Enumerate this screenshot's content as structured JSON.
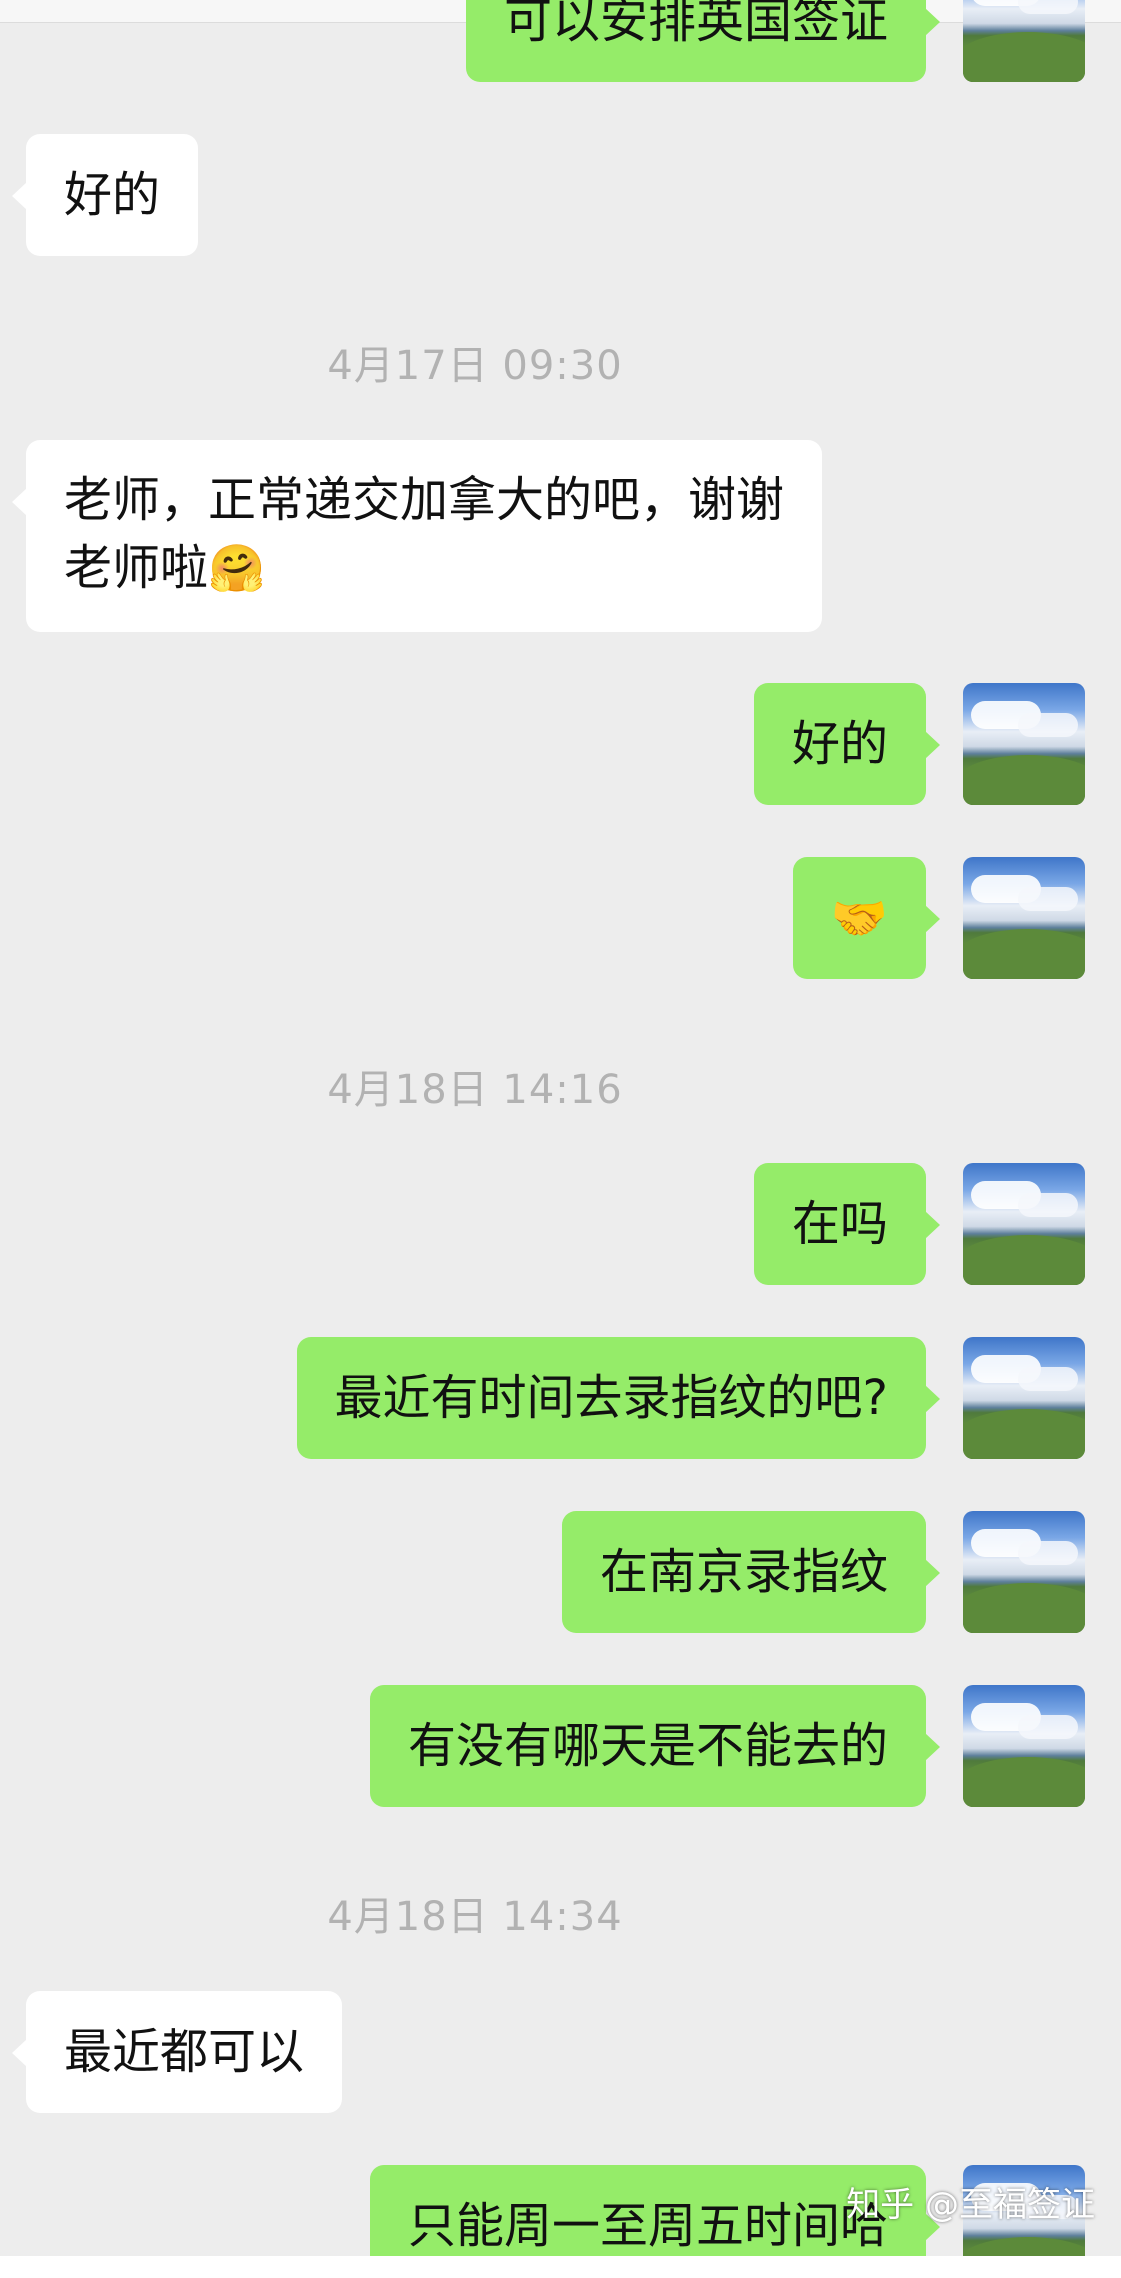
{
  "messages": [
    {
      "side": "right",
      "text": "可以安排英国签证"
    },
    {
      "side": "left",
      "text": "好的"
    },
    {
      "timestamp": "4月17日 09:30"
    },
    {
      "side": "left",
      "line1": "老师，正常递交加拿大的吧，谢谢",
      "line2": "老师啦",
      "emoji": "🤗"
    },
    {
      "side": "right",
      "text": "好的"
    },
    {
      "side": "right",
      "emoji": "🤝"
    },
    {
      "timestamp": "4月18日 14:16"
    },
    {
      "side": "right",
      "text": "在吗"
    },
    {
      "side": "right",
      "text": "最近有时间去录指纹的吧?"
    },
    {
      "side": "right",
      "text": "在南京录指纹"
    },
    {
      "side": "right",
      "text": "有没有哪天是不能去的"
    },
    {
      "timestamp": "4月18日 14:34"
    },
    {
      "side": "left",
      "text": "最近都可以"
    },
    {
      "side": "right",
      "text": "只能周一至周五时间哈"
    }
  ],
  "watermark": "知乎 @至福签证",
  "avatar_icon": "landscape-avatar",
  "colors": {
    "sent": "#95ec69",
    "received": "#ffffff",
    "background": "#ededed",
    "timestamp": "#b2b2b2"
  }
}
